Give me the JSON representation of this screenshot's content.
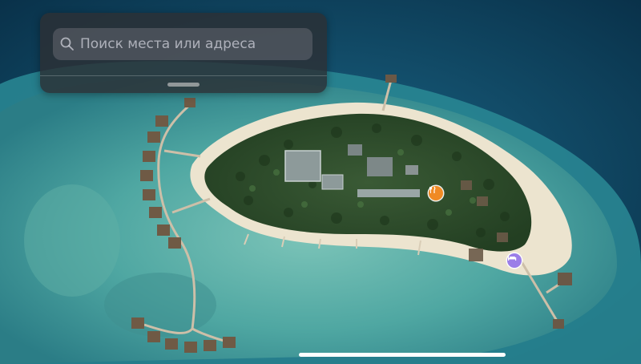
{
  "search": {
    "placeholder": "Поиск места или адреса"
  },
  "map": {
    "view": "satellite",
    "water_deep": "#0d3f5e",
    "lagoon": "#4fa9a3",
    "sand": "#efe8d6",
    "vegetation": "#2c4d2c"
  },
  "pois": [
    {
      "name": "restaurant",
      "icon": "fork-knife-icon",
      "color": "#f08a24"
    },
    {
      "name": "hotel",
      "icon": "bed-icon",
      "color": "#9b7ee8"
    }
  ]
}
